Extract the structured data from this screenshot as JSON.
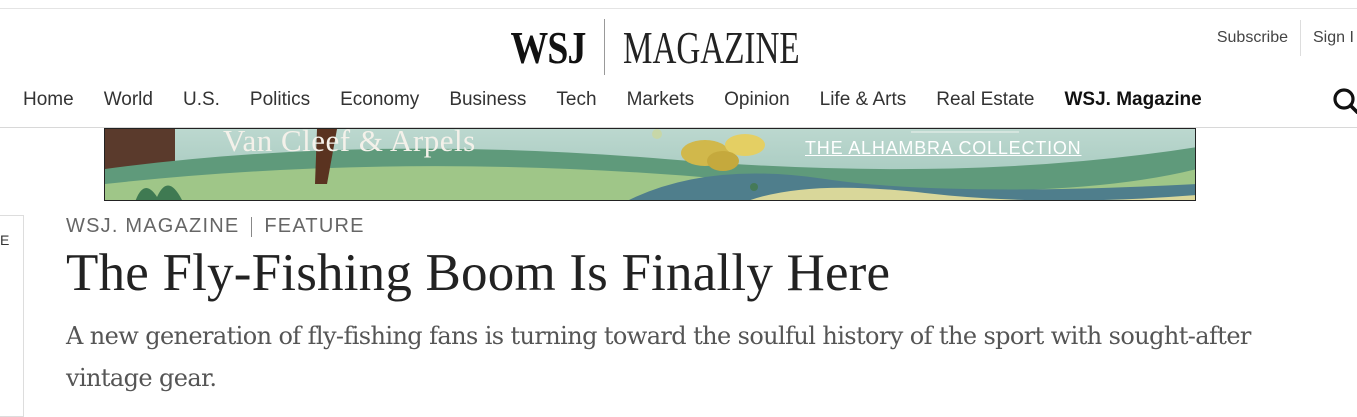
{
  "masthead": {
    "logo_primary": "WSJ",
    "logo_secondary": "MAGAZINE"
  },
  "account": {
    "subscribe_label": "Subscribe",
    "signin_label": "Sign I"
  },
  "nav": {
    "items": [
      {
        "label": "Home"
      },
      {
        "label": "World"
      },
      {
        "label": "U.S."
      },
      {
        "label": "Politics"
      },
      {
        "label": "Economy"
      },
      {
        "label": "Business"
      },
      {
        "label": "Tech"
      },
      {
        "label": "Markets"
      },
      {
        "label": "Opinion"
      },
      {
        "label": "Life & Arts"
      },
      {
        "label": "Real Estate"
      },
      {
        "label": "WSJ. Magazine"
      }
    ],
    "active_item": "WSJ. Magazine",
    "search_icon": "search-icon"
  },
  "ad": {
    "brand": "Van Cleef & Arpels",
    "cta": "THE ALHAMBRA COLLECTION"
  },
  "side_tab": {
    "letter": "E"
  },
  "article": {
    "kicker_section": "WSJ. MAGAZINE",
    "kicker_type": "FEATURE",
    "headline": "The Fly-Fishing Boom Is Finally Here",
    "dek": "A new generation of fly-fishing fans is turning toward the soulful history of the sport with sought-after vintage gear."
  },
  "colors": {
    "text_primary": "#222222",
    "text_secondary": "#555555",
    "kicker": "#666666",
    "rule": "#d8d8d8"
  }
}
